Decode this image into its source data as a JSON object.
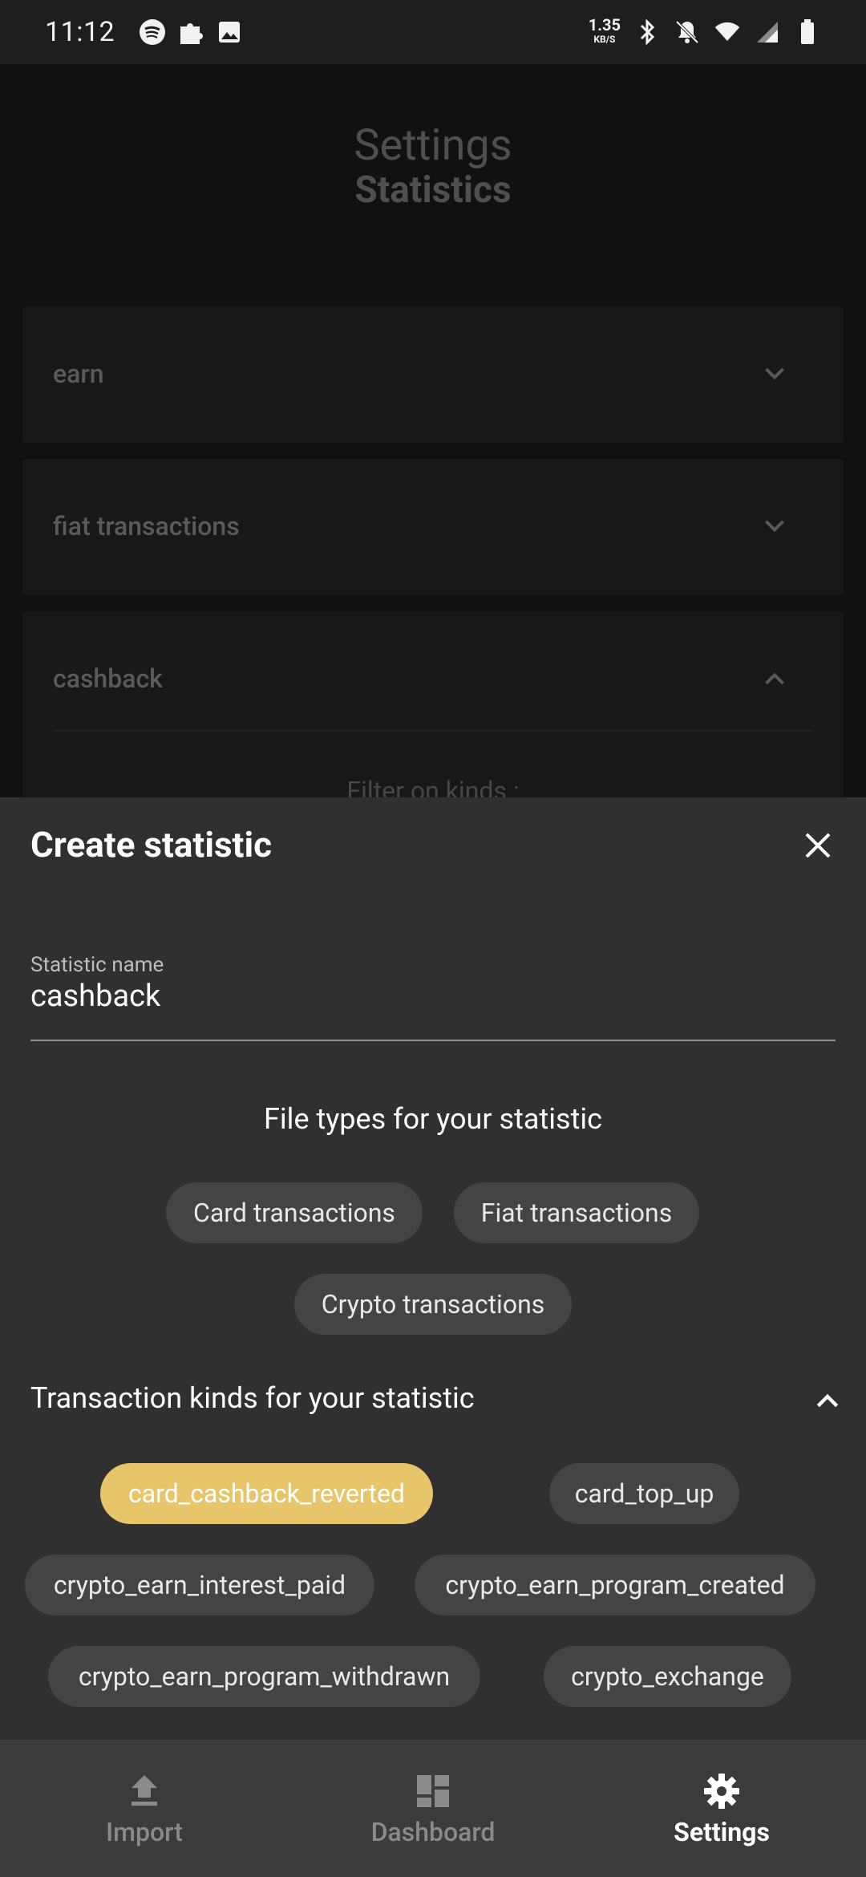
{
  "status_bar": {
    "time": "11:12",
    "net_speed": "1.35",
    "net_unit": "KB/S",
    "left_icons": [
      "spotify-icon",
      "puzzle-icon",
      "image-icon"
    ],
    "right_icons": [
      "bluetooth-icon",
      "notifications-off-icon",
      "wifi-icon",
      "signal-icon",
      "battery-icon"
    ]
  },
  "page": {
    "title": "Settings",
    "subtitle": "Statistics",
    "cards": [
      {
        "label": "earn",
        "expanded": false
      },
      {
        "label": "fiat transactions",
        "expanded": false
      },
      {
        "label": "cashback",
        "expanded": true
      }
    ],
    "filter_text": "Filter on kinds :"
  },
  "sheet": {
    "title": "Create statistic",
    "name_label": "Statistic name",
    "name_value": "cashback",
    "file_types_title": "File types for your statistic",
    "file_types": [
      "Card transactions",
      "Fiat transactions",
      "Crypto transactions"
    ],
    "kinds_title": "Transaction kinds for your statistic",
    "kinds": [
      {
        "label": "card_cashback_reverted",
        "selected": true
      },
      {
        "label": "card_top_up",
        "selected": false
      },
      {
        "label": "crypto_earn_interest_paid",
        "selected": false
      },
      {
        "label": "crypto_earn_program_created",
        "selected": false
      },
      {
        "label": "crypto_earn_program_withdrawn",
        "selected": false
      },
      {
        "label": "crypto_exchange",
        "selected": false
      }
    ],
    "accent_color": "#e8c46a"
  },
  "bottom_nav": {
    "items": [
      {
        "label": "Import",
        "icon": "upload-icon",
        "active": false
      },
      {
        "label": "Dashboard",
        "icon": "dashboard-icon",
        "active": false
      },
      {
        "label": "Settings",
        "icon": "gear-icon",
        "active": true
      }
    ]
  }
}
